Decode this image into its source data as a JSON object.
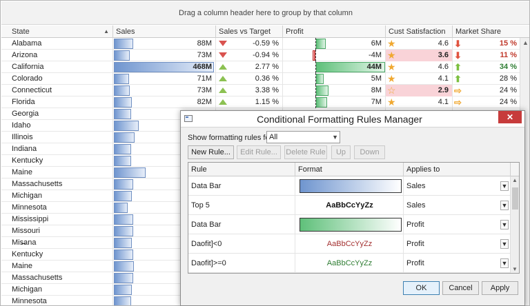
{
  "group_hint": "Drag a column header here to group by that column",
  "columns": [
    "State",
    "Sales",
    "Sales vs Target",
    "Profit",
    "Cust Satisfaction",
    "Market Share"
  ],
  "rows": [
    {
      "state": "Alabama",
      "sales": "88M",
      "sales_frac": 0.19,
      "svt": "-0.59 %",
      "svt_dir": "down",
      "profit": "6M",
      "profit_frac": 0.14,
      "cust": "4.6",
      "cust_highlight": false,
      "mkt": "15 %",
      "mkt_dir": "down",
      "mkt_color": "#c0392b",
      "mkt_bold": true
    },
    {
      "state": "Arizona",
      "sales": "73M",
      "sales_frac": 0.16,
      "svt": "-0.94 %",
      "svt_dir": "down",
      "profit": "-4M",
      "profit_frac": -0.09,
      "cust": "3.6",
      "cust_highlight": true,
      "mkt": "11 %",
      "mkt_dir": "down",
      "mkt_color": "#c0392b",
      "mkt_bold": true
    },
    {
      "state": "California",
      "sales": "468M",
      "sales_frac": 1.0,
      "svt": "2.77 %",
      "svt_dir": "up",
      "profit": "44M",
      "profit_frac": 1.0,
      "cust": "4.6",
      "cust_highlight": false,
      "mkt": "34 %",
      "mkt_dir": "up",
      "mkt_color": "#2e7d32",
      "mkt_bold": true
    },
    {
      "state": "Colorado",
      "sales": "71M",
      "sales_frac": 0.15,
      "svt": "0.36 %",
      "svt_dir": "up",
      "profit": "5M",
      "profit_frac": 0.11,
      "cust": "4.1",
      "cust_highlight": false,
      "mkt": "28 %",
      "mkt_dir": "up",
      "mkt_color": "#222222",
      "mkt_bold": false
    },
    {
      "state": "Connecticut",
      "sales": "73M",
      "sales_frac": 0.16,
      "svt": "3.38 %",
      "svt_dir": "up",
      "profit": "8M",
      "profit_frac": 0.18,
      "cust": "2.9",
      "cust_highlight": true,
      "mkt": "24 %",
      "mkt_dir": "right",
      "mkt_color": "#222222",
      "mkt_bold": false
    },
    {
      "state": "Florida",
      "sales": "82M",
      "sales_frac": 0.18,
      "svt": "1.15 %",
      "svt_dir": "up",
      "profit": "7M",
      "profit_frac": 0.16,
      "cust": "4.1",
      "cust_highlight": false,
      "mkt": "24 %",
      "mkt_dir": "right",
      "mkt_color": "#222222",
      "mkt_bold": false
    },
    {
      "state": "Georgia",
      "sales_frac": 0.17
    },
    {
      "state": "Idaho",
      "sales_frac": 0.25
    },
    {
      "state": "Illinois",
      "sales_frac": 0.21
    },
    {
      "state": "Indiana",
      "sales_frac": 0.17
    },
    {
      "state": "Kentucky",
      "sales_frac": 0.17
    },
    {
      "state": "Maine",
      "sales_frac": 0.32
    },
    {
      "state": "Massachusetts",
      "sales_frac": 0.19
    },
    {
      "state": "Michigan",
      "sales_frac": 0.18
    },
    {
      "state": "Minnesota",
      "sales_frac": 0.14
    },
    {
      "state": "Mississippi",
      "sales_frac": 0.19
    },
    {
      "state": "Missouri",
      "sales_frac": 0.19
    },
    {
      "state": "Mis̶̶ana",
      "sales_frac": 0.18
    },
    {
      "state": "Kentucky",
      "sales_frac": 0.19
    },
    {
      "state": "Maine",
      "sales_frac": 0.2
    },
    {
      "state": "Massachusetts",
      "sales_frac": 0.19
    },
    {
      "state": "Michigan",
      "sales_frac": 0.18
    },
    {
      "state": "Minnesota",
      "sales_frac": 0.17
    }
  ],
  "dialog": {
    "title": "Conditional Formatting Rules Manager",
    "close_glyph": "✕",
    "show_label": "Show formatting rules for:",
    "show_value": "All",
    "buttons": [
      "New Rule...",
      "Edit Rule...",
      "Delete Rule",
      "Up",
      "Down"
    ],
    "rule_headers": [
      "Rule",
      "Format",
      "Applies to"
    ],
    "rules": [
      {
        "name": "Data Bar",
        "format_type": "bar-blue",
        "format_text": "",
        "applies": "Sales"
      },
      {
        "name": "Top 5",
        "format_type": "text",
        "format_text": "AaBbCcYyZz",
        "format_color": "#111111",
        "format_bold": true,
        "applies": "Sales"
      },
      {
        "name": "Data Bar",
        "format_type": "bar-green",
        "format_text": "",
        "applies": "Profit"
      },
      {
        "name": "Daofit]<0",
        "format_type": "text",
        "format_text": "AaBbCcYyZz",
        "format_color": "#a33030",
        "format_bold": false,
        "applies": "Profit"
      },
      {
        "name": "Daofit]>=0",
        "format_type": "text",
        "format_text": "AaBbCcYyZz",
        "format_color": "#2e7d32",
        "format_bold": false,
        "applies": "Profit"
      }
    ],
    "ok_label": "OK",
    "cancel_label": "Cancel",
    "apply_label": "Apply"
  },
  "colors": {
    "accent_blue": "#6f95cf",
    "accent_green": "#5fc07a",
    "negative_red": "#d9534f",
    "close_red": "#c73b3b"
  }
}
